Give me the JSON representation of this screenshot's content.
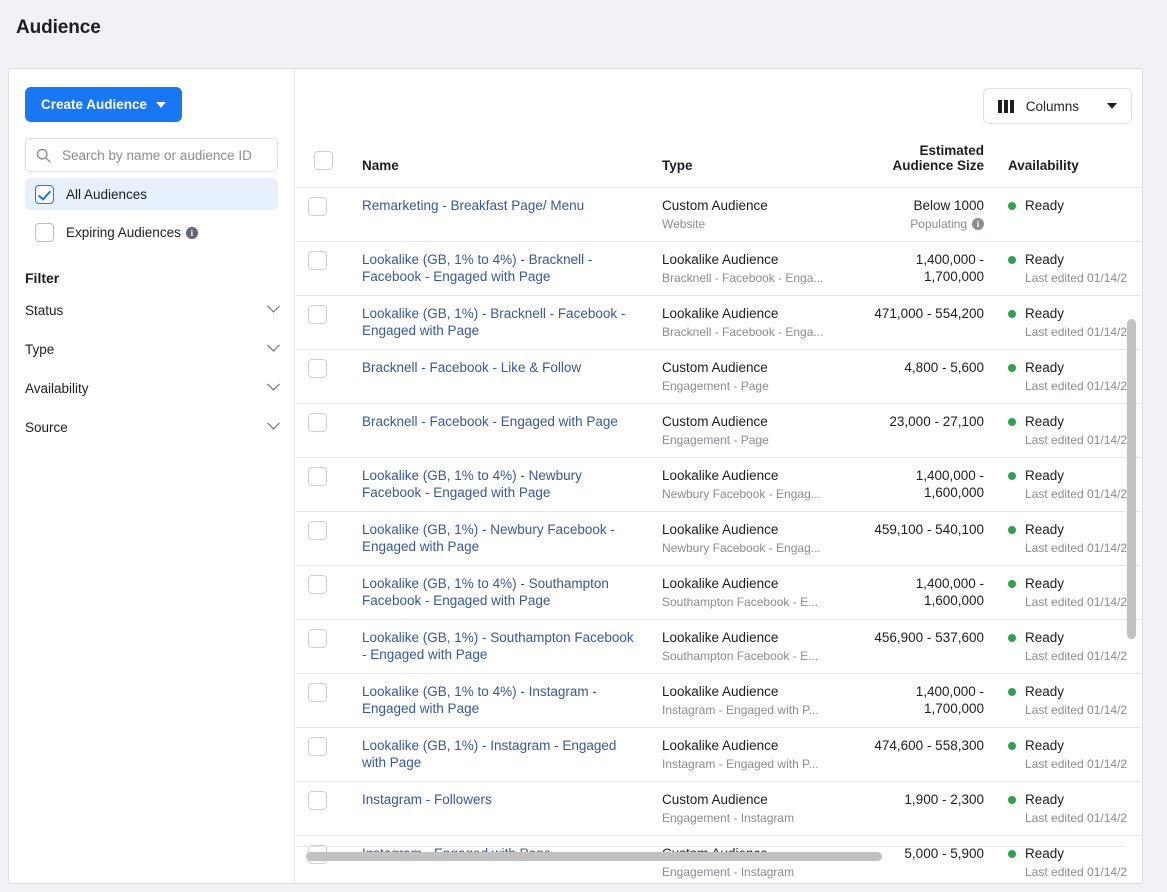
{
  "page": {
    "title": "Audience"
  },
  "sidebar": {
    "create_button": {
      "label": "Create Audience",
      "icon": "chevron-down-icon",
      "color": "#1877f2"
    },
    "search": {
      "placeholder": "Search by name or audience ID",
      "value": "",
      "icon": "search-icon"
    },
    "scopes": [
      {
        "label": "All Audiences",
        "checked": true,
        "info": false
      },
      {
        "label": "Expiring Audiences",
        "checked": false,
        "info": true
      }
    ],
    "filter_title": "Filter",
    "filters": [
      {
        "label": "Status",
        "icon": "chevron-down-icon"
      },
      {
        "label": "Type",
        "icon": "chevron-down-icon"
      },
      {
        "label": "Availability",
        "icon": "chevron-down-icon"
      },
      {
        "label": "Source",
        "icon": "chevron-down-icon"
      }
    ]
  },
  "toolbar": {
    "columns_label": "Columns",
    "columns_icon": "columns-icon",
    "columns_caret": "chevron-down-icon"
  },
  "table": {
    "columns": {
      "name": "Name",
      "type": "Type",
      "size": "Estimated Audience Size",
      "availability": "Availability"
    },
    "status_color": "#31a24c",
    "rows": [
      {
        "name": "Remarketing - Breakfast Page/ Menu",
        "type": "Custom Audience",
        "source": "Website",
        "size": "Below 1000",
        "size_sub": "Populating",
        "size_sub_info": true,
        "availability": "Ready",
        "availability_sub": ""
      },
      {
        "name": "Lookalike (GB, 1% to 4%) - Bracknell - Facebook - Engaged with Page",
        "type": "Lookalike Audience",
        "source": "Bracknell - Facebook - Enga...",
        "size": "1,400,000 - 1,700,000",
        "size_sub": "",
        "size_sub_info": false,
        "availability": "Ready",
        "availability_sub": "Last edited 01/14/2"
      },
      {
        "name": "Lookalike (GB, 1%) - Bracknell - Facebook - Engaged with Page",
        "type": "Lookalike Audience",
        "source": "Bracknell - Facebook - Enga...",
        "size": "471,000 - 554,200",
        "size_sub": "",
        "size_sub_info": false,
        "availability": "Ready",
        "availability_sub": "Last edited 01/14/2"
      },
      {
        "name": "Bracknell - Facebook - Like & Follow",
        "type": "Custom Audience",
        "source": "Engagement - Page",
        "size": "4,800 - 5,600",
        "size_sub": "",
        "size_sub_info": false,
        "availability": "Ready",
        "availability_sub": "Last edited 01/14/2"
      },
      {
        "name": "Bracknell - Facebook - Engaged with Page",
        "type": "Custom Audience",
        "source": "Engagement - Page",
        "size": "23,000 - 27,100",
        "size_sub": "",
        "size_sub_info": false,
        "availability": "Ready",
        "availability_sub": "Last edited 01/14/2"
      },
      {
        "name": "Lookalike (GB, 1% to 4%) - Newbury Facebook - Engaged with Page",
        "type": "Lookalike Audience",
        "source": "Newbury Facebook - Engag...",
        "size": "1,400,000 - 1,600,000",
        "size_sub": "",
        "size_sub_info": false,
        "availability": "Ready",
        "availability_sub": "Last edited 01/14/2"
      },
      {
        "name": "Lookalike (GB, 1%) - Newbury Facebook - Engaged with Page",
        "type": "Lookalike Audience",
        "source": "Newbury Facebook - Engag...",
        "size": "459,100 - 540,100",
        "size_sub": "",
        "size_sub_info": false,
        "availability": "Ready",
        "availability_sub": "Last edited 01/14/2"
      },
      {
        "name": "Lookalike (GB, 1% to 4%) - Southampton Facebook - Engaged with Page",
        "type": "Lookalike Audience",
        "source": "Southampton Facebook - E...",
        "size": "1,400,000 - 1,600,000",
        "size_sub": "",
        "size_sub_info": false,
        "availability": "Ready",
        "availability_sub": "Last edited 01/14/2"
      },
      {
        "name": "Lookalike (GB, 1%) - Southampton Facebook - Engaged with Page",
        "type": "Lookalike Audience",
        "source": "Southampton Facebook - E...",
        "size": "456,900 - 537,600",
        "size_sub": "",
        "size_sub_info": false,
        "availability": "Ready",
        "availability_sub": "Last edited 01/14/2"
      },
      {
        "name": "Lookalike (GB, 1% to 4%) - Instagram - Engaged with Page",
        "type": "Lookalike Audience",
        "source": "Instagram - Engaged with P...",
        "size": "1,400,000 - 1,700,000",
        "size_sub": "",
        "size_sub_info": false,
        "availability": "Ready",
        "availability_sub": "Last edited 01/14/2"
      },
      {
        "name": "Lookalike (GB, 1%) - Instagram - Engaged with Page",
        "type": "Lookalike Audience",
        "source": "Instagram - Engaged with P...",
        "size": "474,600 - 558,300",
        "size_sub": "",
        "size_sub_info": false,
        "availability": "Ready",
        "availability_sub": "Last edited 01/14/2"
      },
      {
        "name": "Instagram - Followers",
        "type": "Custom Audience",
        "source": "Engagement - Instagram",
        "size": "1,900 - 2,300",
        "size_sub": "",
        "size_sub_info": false,
        "availability": "Ready",
        "availability_sub": "Last edited 01/14/2"
      },
      {
        "name": "Instagram - Engaged with Page",
        "type": "Custom Audience",
        "source": "Engagement - Instagram",
        "size": "5,000 - 5,900",
        "size_sub": "",
        "size_sub_info": false,
        "availability": "Ready",
        "availability_sub": "Last edited 01/14/2"
      }
    ]
  }
}
